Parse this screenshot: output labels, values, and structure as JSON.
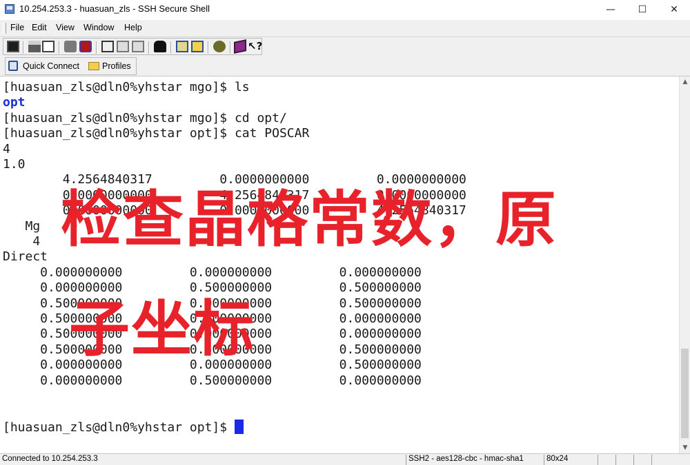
{
  "window": {
    "title": "10.254.253.3 - huasuan_zls - SSH Secure Shell",
    "controls": {
      "minimize": "—",
      "maximize": "☐",
      "close": "✕"
    }
  },
  "menu": [
    "File",
    "Edit",
    "View",
    "Window",
    "Help"
  ],
  "toolbar": {
    "icons": [
      "save-icon",
      "print-icon",
      "print-preview-icon",
      "disconnect-icon",
      "connect-icon",
      "copy-icon",
      "paste-icon",
      "paste-alt-icon",
      "find-icon",
      "settings-icon",
      "profile-icon",
      "sftp-icon",
      "book-icon",
      "help-icon"
    ]
  },
  "quickbar": {
    "quick_connect": "Quick Connect",
    "profiles": "Profiles"
  },
  "terminal": {
    "lines": [
      "[huasuan_zls@dln0%yhstar mgo]$ ls",
      "opt",
      "[huasuan_zls@dln0%yhstar mgo]$ cd opt/",
      "[huasuan_zls@dln0%yhstar opt]$ cat POSCAR",
      "4",
      "1.0",
      "        4.2564840317         0.0000000000         0.0000000000",
      "        0.0000000000         4.2564840317         0.0000000000",
      "        0.0000000000         0.0000000000         4.2564840317",
      "   Mg    O",
      "    4    4",
      "Direct",
      "     0.000000000         0.000000000         0.000000000",
      "     0.000000000         0.500000000         0.500000000",
      "     0.500000000         0.000000000         0.500000000",
      "     0.500000000         0.500000000         0.000000000",
      "     0.500000000         0.000000000         0.000000000",
      "     0.500000000         0.500000000         0.500000000",
      "     0.000000000         0.000000000         0.500000000",
      "     0.000000000         0.500000000         0.000000000",
      "",
      "",
      "[huasuan_zls@dln0%yhstar opt]$ "
    ],
    "highlight_line": 1,
    "highlight_color": "#1a2fd6",
    "cursor_color": "#1a28e8"
  },
  "overlay": {
    "line1": "检查晶格常数，原",
    "line2": "子坐标",
    "color": "#e8222a"
  },
  "status": {
    "connection": "Connected to 10.254.253.3",
    "cipher": "SSH2 - aes128-cbc - hmac-sha1",
    "size": "80x24"
  }
}
